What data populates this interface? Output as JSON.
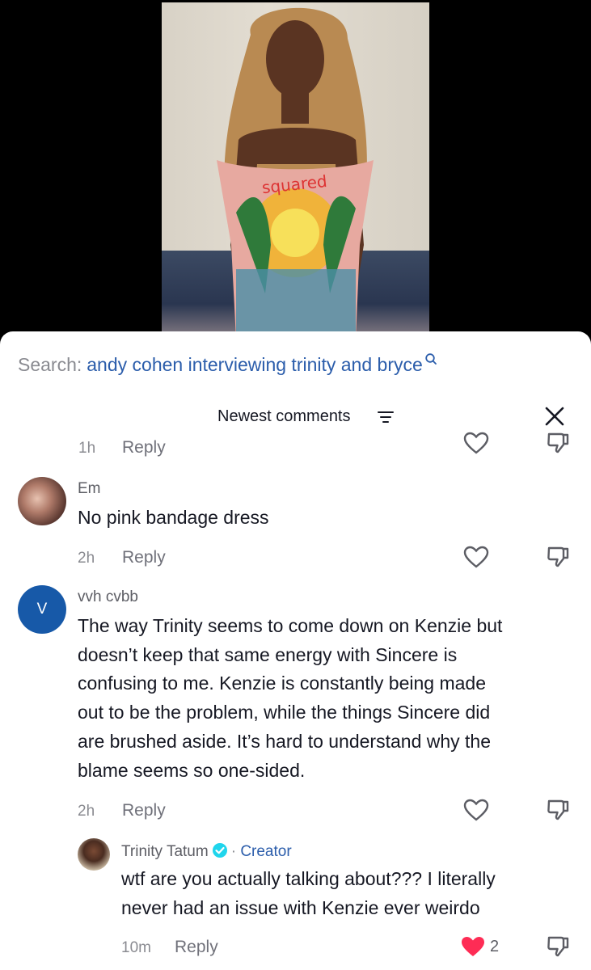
{
  "search": {
    "label": "Search:",
    "query": "andy cohen interviewing trinity and bryce"
  },
  "header": {
    "sort_label": "Newest comments"
  },
  "partial_row": {
    "time": "1h",
    "reply": "Reply"
  },
  "comments": [
    {
      "username": "Em",
      "text": "No pink bandage dress",
      "time": "2h",
      "reply": "Reply"
    },
    {
      "username": "vvh cvbb",
      "avatar_letter": "V",
      "lines": [
        "The way Trinity seems to come down on Kenzie but",
        "doesn’t keep that same energy with Sincere is",
        "confusing to me. Kenzie is constantly being made",
        "out to be the problem, while the things Sincere did",
        "are brushed aside. It’s hard to understand why the",
        "blame seems so one-sided."
      ],
      "time": "2h",
      "reply": "Reply"
    }
  ],
  "reply_comment": {
    "username": "Trinity Tatum",
    "separator": "·",
    "badge": "Creator",
    "lines": [
      "wtf are you actually talking about??? I literally",
      "never had an issue with Kenzie ever weirdo"
    ],
    "time": "10m",
    "reply": "Reply",
    "likes": "2"
  },
  "colors": {
    "link": "#2b5dab",
    "liked": "#fe2c55",
    "avatar_v": "#1759a8",
    "verified": "#20d5ec"
  },
  "icons": {
    "search": "search-icon",
    "sort": "sort-lines-icon",
    "close": "close-icon",
    "heart": "heart-outline-icon",
    "heart_filled": "heart-filled-icon",
    "dislike": "thumbs-down-icon",
    "verified": "verified-badge-icon"
  }
}
